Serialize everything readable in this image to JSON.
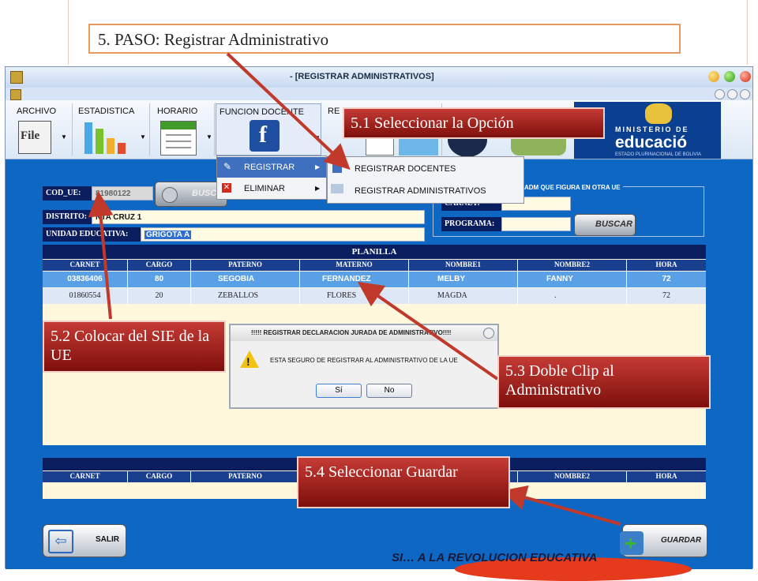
{
  "slide": {
    "step_title": "5. PASO: Registrar  Administrativo",
    "footer": "SI… A LA REVOLUCION EDUCATIVA"
  },
  "window": {
    "title": "- [REGISTRAR ADMINISTRATIVOS]"
  },
  "ribbon": {
    "groups": [
      {
        "label": "ARCHIVO",
        "icon": "file-icon"
      },
      {
        "label": "ESTADISTICA",
        "icon": "bar-chart-icon"
      },
      {
        "label": "HORARIO",
        "icon": "calendar-icon"
      },
      {
        "label": "FUNCION DOCENTE",
        "icon": "facebook-edit-icon"
      },
      {
        "label": "RE",
        "icon": "report-icon"
      }
    ],
    "file_glyph": "File",
    "banner_text": "MINISTERIO DE",
    "banner_brand": "educació",
    "banner_sub": "ESTADO PLURINACIONAL DE BOLIVIA"
  },
  "menus": {
    "primary": [
      {
        "label": "REGISTRAR",
        "arrow": "▶"
      },
      {
        "label": "ELIMINAR",
        "arrow": "▶"
      }
    ],
    "submenu": [
      {
        "label": "REGISTRAR DOCENTES"
      },
      {
        "label": "REGISTRAR ADMINISTRATIVOS"
      }
    ]
  },
  "form": {
    "cod_ue_label": "COD_UE:",
    "cod_ue_value": "81980122",
    "buscar_label": "BUSC",
    "distrito_label": "DISTRITO:",
    "distrito_value": "NTA CRUZ 1",
    "unidad_label": "UNIDAD EDUCATIVA:",
    "unidad_value": "GRIGOTA A",
    "right_panel_title": "ADM QUE FIGURA EN OTRA UE",
    "carnet_label": "CARNET:",
    "programa_label": "PROGRAMA:",
    "buscar2_label": "BUSCAR"
  },
  "planilla": {
    "title": "PLANILLA",
    "columns": [
      "CARNET",
      "CARGO",
      "PATERNO",
      "MATERNO",
      "NOMBRE1",
      "NOMBRE2",
      "HORA"
    ],
    "rows": [
      [
        "03836406",
        "80",
        "SEGOBIA",
        "FERNANDEZ",
        "MELBY",
        "FANNY",
        "72"
      ],
      [
        "01860554",
        "20",
        "ZEBALLOS",
        "FLORES",
        "MAGDA",
        ".",
        "72"
      ]
    ]
  },
  "bottom_table": {
    "columns": [
      "CARNET",
      "CARGO",
      "PATERNO",
      "",
      "",
      "NOMBRE2",
      "HORA"
    ]
  },
  "dialog": {
    "title": "!!!!! REGISTRAR DECLARACION JURADA DE ADMINISTRATIVO!!!!",
    "message": "ESTA SEGURO DE REGISTRAR AL ADMINISTRATIVO DE LA UE",
    "yes": "Sí",
    "no": "No"
  },
  "buttons": {
    "salir": "SALIR",
    "guardar": "GUARDAR"
  },
  "callouts": {
    "c1": "5.1 Seleccionar la Opción",
    "c2": "5.2  Colocar del SIE de la UE",
    "c3": "5.3  Doble Clip al Administrativo",
    "c4": "5.4 Seleccionar Guardar"
  },
  "colors": {
    "callout_red": "#a3231d",
    "arrow_red": "#c0392b",
    "form_blue": "#0e67c3",
    "header_navy": "#1a3f8e",
    "selected_row": "#5aa0e6"
  }
}
